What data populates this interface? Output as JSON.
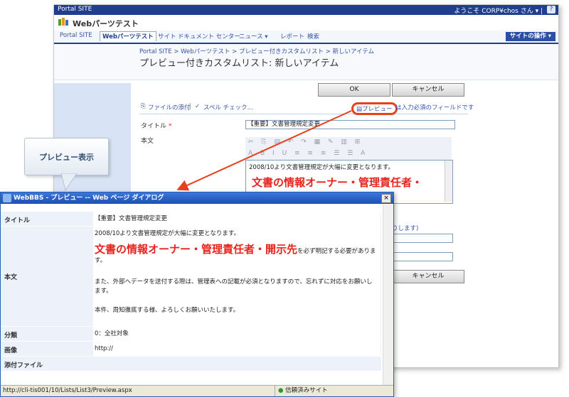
{
  "topbar": {
    "site": "Portal SITE",
    "welcome": "ようこそ CORP¥chos さん ▾ |",
    "help": "?"
  },
  "site_title": "Webパーツテスト",
  "tabs": [
    "Portal SITE",
    "Webパーツテスト",
    "サイト",
    "ドキュメント センター",
    "ニュース ▾",
    "レポート",
    "検索"
  ],
  "site_actions": "サイトの操作 ▾",
  "breadcrumb": "Portal SITE > Webパーツテスト > プレビュー付きカスタムリスト > 新しいアイテム",
  "page_title": "プレビュー付きカスタムリスト: 新しいアイテム",
  "buttons": {
    "ok": "OK",
    "cancel": "キャンセル",
    "cancel2": "キャンセル"
  },
  "toolbar": {
    "attach": "ファイルの添付",
    "sep": "|",
    "spell": "スペル チェック...",
    "preview": "プレビュー",
    "required_note": "は入力必須のフィールドです"
  },
  "form": {
    "title_label": "タイトル",
    "required_mark": "*",
    "title_value": "【重要】文書管理規定変更",
    "body_label": "本文",
    "body_line1": "2008/10より文書管理規定が大幅に変更となります。",
    "body_big": "文書の情報オーナー・管理責任者・",
    "partial1": "りします)"
  },
  "callout": "プレビュー表示",
  "dialog": {
    "title": "WebBBS - プレビュー -- Web ページ ダイアログ",
    "close": "×",
    "rows": {
      "title_label": "タイトル",
      "title_value": "【重要】文書管理規定変更",
      "body_label": "本文",
      "body_p1": "2008/10より文書管理規定が大幅に変更となります。",
      "body_big": "文書の情報オーナー・管理責任者・開示先",
      "body_big_tail": "を必ず明記する必要があります。",
      "body_p3": "また、外部へデータを送付する際は、管理表への記載が必須となりますので、忘れずに対応をお願いします。",
      "body_p4": "本件、周知徹底する様、よろしくお願いいたします。",
      "category_label": "分類",
      "category_value": "0：全社対象",
      "image_label": "画像",
      "image_value": "http://",
      "attach_label": "添付ファイル",
      "attach_value": ""
    },
    "status_url": "http://cli-tis001/10/Lists/List3/Preview.aspx",
    "status_zone": "信頼済みサイト"
  },
  "colors": {
    "accent": "#1f3f8e",
    "highlight_red": "#e8211b",
    "arrow": "#e8401c"
  }
}
